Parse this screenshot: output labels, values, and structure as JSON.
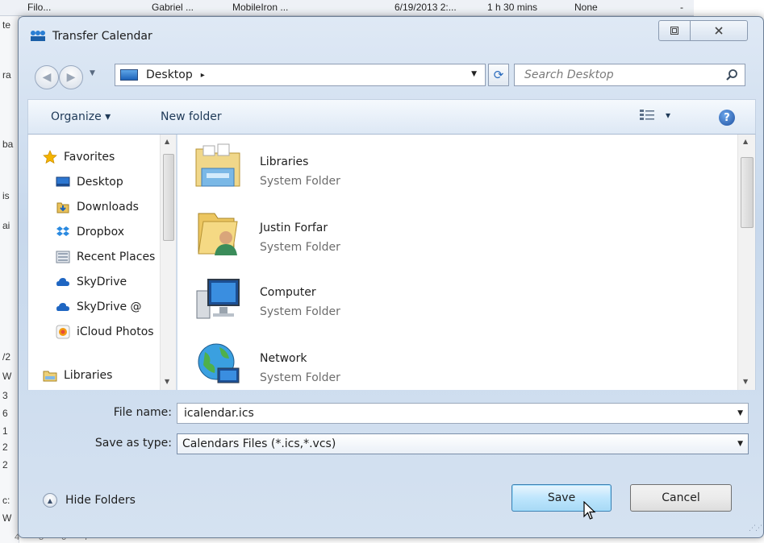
{
  "background_app": {
    "top_row": [
      "Filo...",
      "Gabriel ...",
      "MobileIron ...",
      "6/19/2013 2:...",
      "1 h 30 mins",
      "None",
      "-"
    ],
    "left_fragments": [
      "te",
      "ra",
      "ba",
      "is",
      "ai",
      "/2",
      "W",
      "3",
      "6",
      "1",
      "2",
      "2",
      "c:",
      "W"
    ],
    "bottom_row": [
      "4",
      "5",
      "6",
      "7"
    ]
  },
  "dialog": {
    "title": "Transfer Calendar",
    "address": {
      "location": "Desktop",
      "separator": "▸"
    },
    "search": {
      "placeholder": "Search Desktop"
    },
    "toolbar": {
      "organize": "Organize ▾",
      "new_folder": "New folder",
      "view_arrow": "▾",
      "help": "?"
    },
    "nav": {
      "favorites": "Favorites",
      "items": [
        "Desktop",
        "Downloads",
        "Dropbox",
        "Recent Places",
        "SkyDrive",
        "SkyDrive @",
        "iCloud Photos"
      ],
      "libraries": "Libraries"
    },
    "files": [
      {
        "name": "Libraries",
        "type": "System Folder",
        "icon": "libraries-icon"
      },
      {
        "name": "Justin Forfar",
        "type": "System Folder",
        "icon": "user-folder-icon"
      },
      {
        "name": "Computer",
        "type": "System Folder",
        "icon": "computer-icon"
      },
      {
        "name": "Network",
        "type": "System Folder",
        "icon": "network-icon"
      }
    ],
    "file_name": {
      "label": "File name:",
      "value": "icalendar.ics"
    },
    "save_type": {
      "label": "Save as type:",
      "value": "Calendars Files (*.ics,*.vcs)"
    },
    "hide_folders": "Hide Folders",
    "save_button": "Save",
    "cancel_button": "Cancel"
  },
  "colors": {
    "chrome": "#c7d8ec",
    "toolbar": "#dde8f5",
    "save_button": "#bee6fd",
    "accent": "#1d63b9"
  }
}
